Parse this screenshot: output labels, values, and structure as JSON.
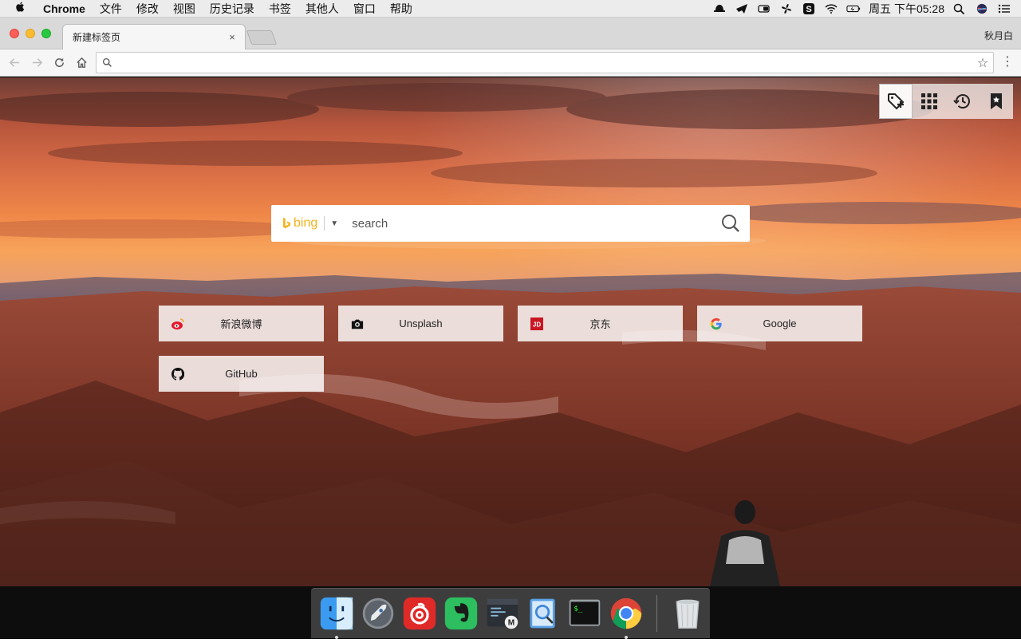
{
  "menubar": {
    "apple": "",
    "items": [
      "Chrome",
      "文件",
      "修改",
      "视图",
      "历史记录",
      "书签",
      "其他人",
      "窗口",
      "帮助"
    ],
    "clock": "周五 下午05:28",
    "status_icons": [
      "hat-icon",
      "send-icon",
      "battery-toggle-icon",
      "fan-icon",
      "s-app-icon",
      "wifi-icon",
      "battery-icon",
      "search-icon",
      "siri-icon",
      "list-icon"
    ]
  },
  "browser": {
    "tab_title": "新建标签页",
    "tab_close": "×",
    "profile_name": "秋月白",
    "omnibox": {
      "value": "",
      "placeholder": ""
    }
  },
  "newtab": {
    "extension_toolbar": [
      "add-bookmark-icon",
      "apps-grid-icon",
      "history-icon",
      "bookmark-icon"
    ],
    "search": {
      "engine": "bing",
      "placeholder": "search"
    },
    "tiles": [
      {
        "label": "新浪微博",
        "icon": "weibo-icon"
      },
      {
        "label": "Unsplash",
        "icon": "camera-icon"
      },
      {
        "label": "京东",
        "icon": "jd-icon"
      },
      {
        "label": "Google",
        "icon": "google-icon"
      },
      {
        "label": "GitHub",
        "icon": "github-icon"
      }
    ]
  },
  "dock": {
    "apps": [
      "Finder",
      "Launchpad",
      "NetEase Music",
      "Evernote",
      "Markdown Editor",
      "Safari Web Inspector",
      "Terminal",
      "Chrome"
    ],
    "running": [
      "Finder",
      "Chrome"
    ]
  }
}
